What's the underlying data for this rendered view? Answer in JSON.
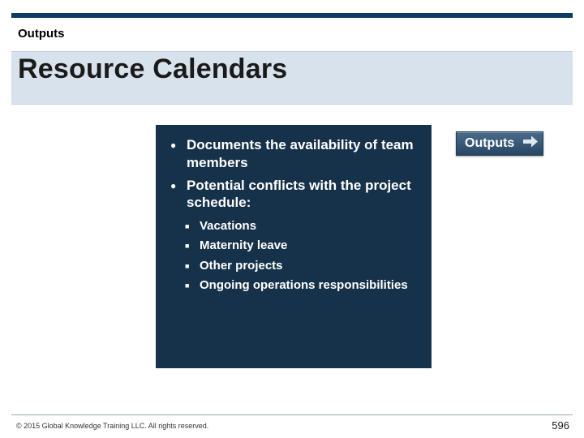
{
  "kicker": "Outputs",
  "title": "Resource Calendars",
  "badge": {
    "label": "Outputs"
  },
  "bullets": [
    "Documents the availability of team members",
    "Potential conflicts with the project schedule:"
  ],
  "subbullets": [
    "Vacations",
    "Maternity leave",
    "Other projects",
    "Ongoing operations responsibilities"
  ],
  "footer": {
    "copyright": "© 2015 Global Knowledge Training LLC. All rights reserved.",
    "page": "596"
  }
}
